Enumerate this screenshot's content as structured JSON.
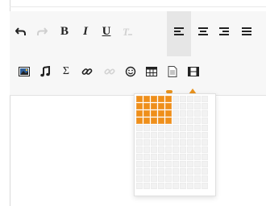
{
  "toolbar": {
    "row1": [
      {
        "name": "undo-button",
        "icon": "undo-icon",
        "state": "enabled"
      },
      {
        "name": "redo-button",
        "icon": "redo-icon",
        "state": "disabled"
      },
      {
        "name": "bold-button",
        "label": "B",
        "state": "enabled"
      },
      {
        "name": "italic-button",
        "label": "I",
        "state": "enabled"
      },
      {
        "name": "underline-button",
        "label": "U",
        "state": "enabled"
      },
      {
        "name": "clear-format-button",
        "icon": "clear-format-icon",
        "state": "disabled"
      },
      {
        "name": "align-left-button",
        "icon": "align-left-icon",
        "state": "active"
      },
      {
        "name": "align-center-button",
        "icon": "align-center-icon",
        "state": "enabled"
      },
      {
        "name": "align-right-button",
        "icon": "align-right-icon",
        "state": "enabled"
      },
      {
        "name": "align-justify-button",
        "icon": "align-justify-icon",
        "state": "enabled"
      }
    ],
    "row2": [
      {
        "name": "insert-image-button",
        "icon": "image-icon",
        "state": "enabled"
      },
      {
        "name": "insert-music-button",
        "icon": "music-note-icon",
        "state": "enabled"
      },
      {
        "name": "insert-formula-button",
        "label": "Σ",
        "state": "enabled"
      },
      {
        "name": "insert-link-button",
        "icon": "link-icon",
        "state": "enabled"
      },
      {
        "name": "unlink-button",
        "icon": "unlink-icon",
        "state": "disabled"
      },
      {
        "name": "insert-emoji-button",
        "icon": "smiley-icon",
        "state": "enabled"
      },
      {
        "name": "insert-table-button",
        "icon": "table-icon",
        "state": "active"
      },
      {
        "name": "insert-file-button",
        "icon": "document-icon",
        "state": "enabled"
      },
      {
        "name": "insert-video-button",
        "icon": "film-icon",
        "state": "enabled"
      }
    ]
  },
  "table_picker": {
    "columns": 10,
    "rows": 13,
    "selected_columns": 5,
    "selected_rows": 4
  },
  "colors": {
    "accent": "#ef8f1a",
    "toolbar_bg": "#f7f7f7",
    "active_bg": "#e4e4e4"
  }
}
